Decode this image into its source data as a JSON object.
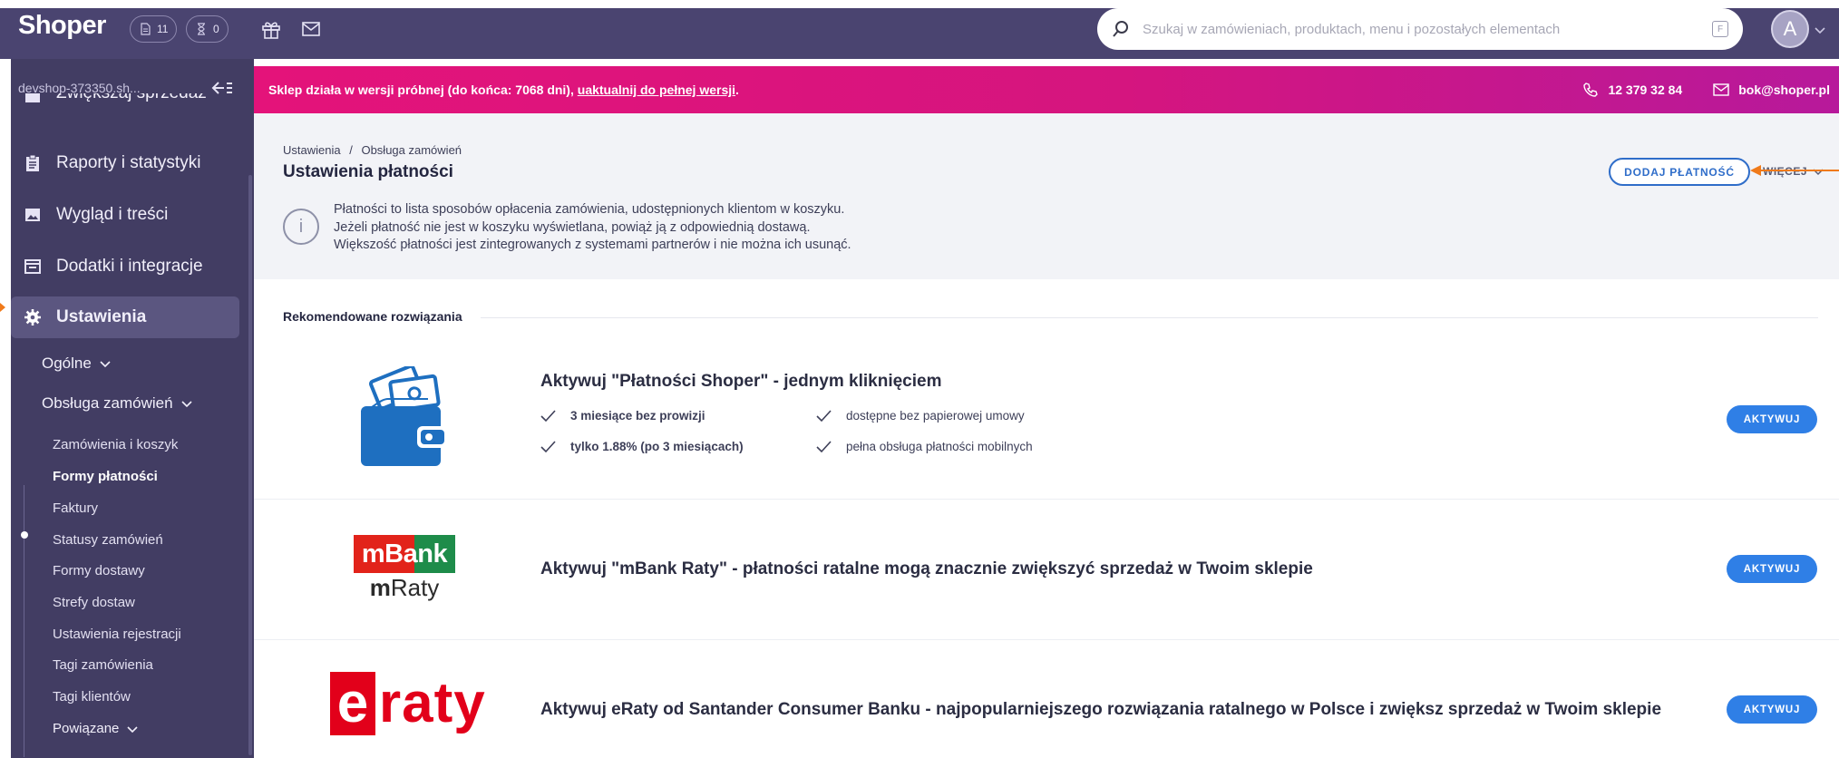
{
  "topbar": {
    "logo": "Shoper",
    "pill_orders": "11",
    "pill_pending": "0",
    "search_placeholder": "Szukaj w zamówieniach, produktach, menu i pozostałych elementach",
    "search_shortcut": "F",
    "avatar_letter": "A"
  },
  "sidebar": {
    "shop_name": "devshop-373350.sh...",
    "partial_item": "Zwiększaj sprzedaż",
    "items": [
      {
        "label": "Raporty i statystyki",
        "icon": "clipboard-icon"
      },
      {
        "label": "Wygląd i treści",
        "icon": "image-icon"
      },
      {
        "label": "Dodatki i integracje",
        "icon": "window-icon"
      },
      {
        "label": "Ustawienia",
        "icon": "gear-icon"
      }
    ],
    "general": "Ogólne",
    "order_handling": "Obsługa zamówień",
    "sub_items": [
      "Zamówienia i koszyk",
      "Formy płatności",
      "Faktury",
      "Statusy zamówień",
      "Formy dostawy",
      "Strefy dostaw",
      "Ustawienia rejestracji",
      "Tagi zamówienia",
      "Tagi klientów"
    ],
    "related": "Powiązane"
  },
  "banner": {
    "text": "Sklep działa w wersji próbnej (do końca: 7068 dni), ",
    "link": "uaktualnij do pełnej wersji",
    "suffix": ".",
    "phone": "12 379 32 84",
    "email": "bok@shoper.pl"
  },
  "page": {
    "breadcrumb_1": "Ustawienia",
    "breadcrumb_sep": "/",
    "breadcrumb_2": "Obsługa zamówień",
    "title": "Ustawienia płatności",
    "info_line_1": "Płatności to lista sposobów opłacenia zamówienia, udostępnionych klientom w koszyku.",
    "info_line_2": "Jeżeli płatność nie jest w koszyku wyświetlana, powiąż ją z odpowiednią dostawą.",
    "info_line_3": "Większość płatności jest zintegrowanych z systemami partnerów i nie można ich usunąć.",
    "add_payment": "DODAJ PŁATNOŚĆ",
    "more": "WIĘCEJ"
  },
  "recommended": {
    "label": "Rekomendowane rozwiązania",
    "cards": [
      {
        "title": "Aktywuj \"Płatności Shoper\" - jednym kliknięciem",
        "features": [
          "3 miesiące bez prowizji",
          "dostępne bez papierowej umowy",
          "tylko 1.88% (po 3 miesiącach)",
          "pełna obsługa płatności mobilnych"
        ],
        "button": "AKTYWUJ"
      },
      {
        "title": "Aktywuj \"mBank Raty\" - płatności ratalne mogą znacznie zwiększyć sprzedaż w Twoim sklepie",
        "logo_top": "mBank",
        "logo_bottom_bold": "m",
        "logo_bottom": "Raty",
        "button": "AKTYWUJ"
      },
      {
        "title": "Aktywuj eRaty od Santander Consumer Banku - najpopularniejszego rozwiązania ratalnego w Polsce i zwiększ sprzedaż w Twoim sklepie",
        "logo_e": "e",
        "logo_rest": "raty",
        "button": "AKTYWUJ"
      }
    ]
  },
  "colors": {
    "topbar": "#4a4470",
    "sidebar": "#423d63",
    "banner": "#e4137a",
    "accent": "#2f7fe6",
    "annotation_arrow": "#f07a1a"
  }
}
